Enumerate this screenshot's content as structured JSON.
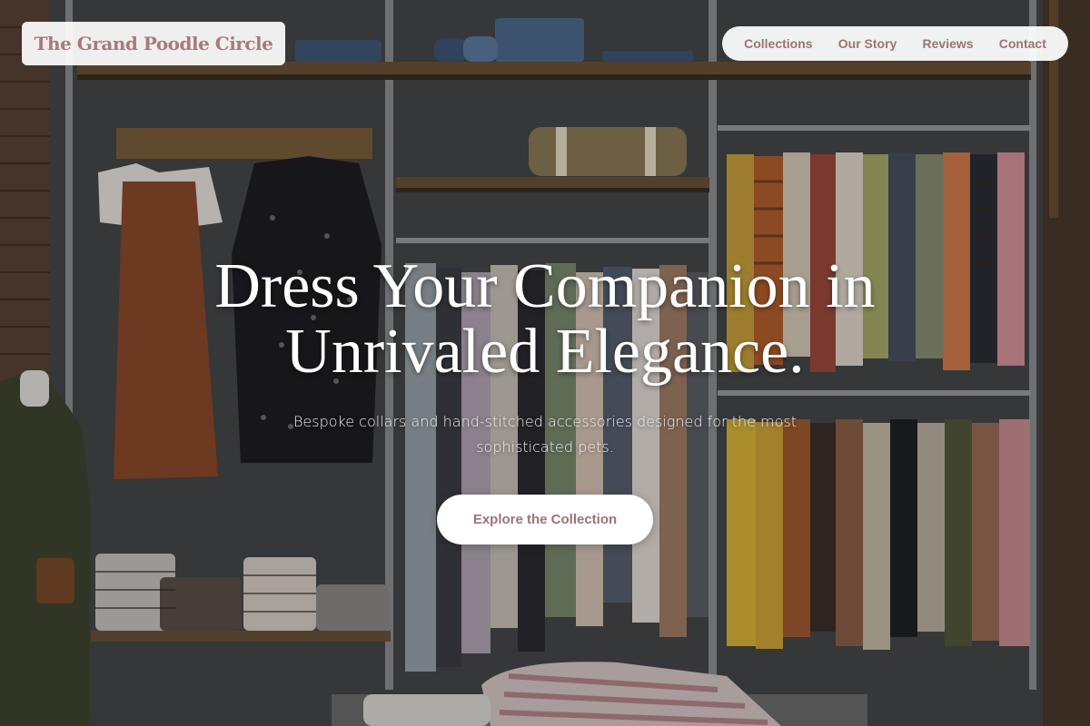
{
  "brand": {
    "name": "The Grand Poodle Circle"
  },
  "nav": {
    "items": [
      {
        "label": "Collections"
      },
      {
        "label": "Our Story"
      },
      {
        "label": "Reviews"
      },
      {
        "label": "Contact"
      }
    ]
  },
  "hero": {
    "headline_line1": "Dress Your Companion in",
    "headline_line2": "Unrivaled Elegance.",
    "subheadline": "Bespoke collars and hand-stitched accessories designed for the most sophisticated pets.",
    "cta_label": "Explore the Collection",
    "background": "boutique-clothing-racks-photo"
  },
  "colors": {
    "accent": "#9c7377",
    "brand_text": "#a87a7d",
    "pill_bg": "#ffffff"
  }
}
